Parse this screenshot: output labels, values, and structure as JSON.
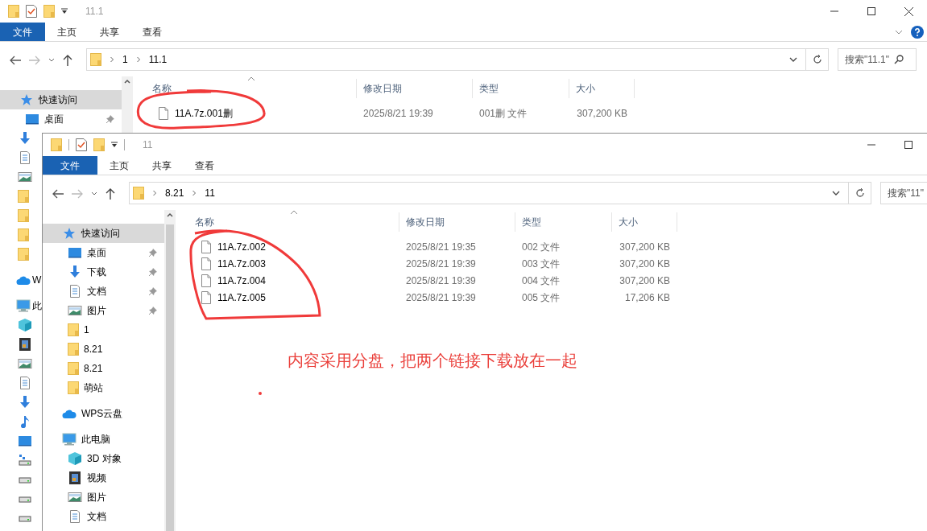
{
  "back_window": {
    "title": "11.1",
    "ribbon_tabs": [
      {
        "kind": "file-menu",
        "label": "文件"
      },
      {
        "kind": "tab",
        "label": "主页"
      },
      {
        "kind": "tab",
        "label": "共享"
      },
      {
        "kind": "tab",
        "label": "查看"
      }
    ],
    "breadcrumb": [
      "1",
      "11.1"
    ],
    "search": {
      "placeholder": "搜索\"11.1\""
    },
    "sidebar": [
      {
        "kind": "quick-access",
        "label": "快速访问",
        "selected": true,
        "children": [
          {
            "kind": "desktop",
            "label": "桌面",
            "pinned": true
          },
          {
            "kind": "download"
          },
          {
            "kind": "document"
          },
          {
            "kind": "pictures"
          },
          {
            "kind": "folder"
          },
          {
            "kind": "folder"
          },
          {
            "kind": "folder"
          },
          {
            "kind": "folder"
          }
        ]
      },
      {
        "kind": "cloud",
        "label": "W",
        "selected": false
      },
      {
        "kind": "computer",
        "label": "此",
        "selected": false,
        "children": [
          {
            "kind": "cube"
          },
          {
            "kind": "video"
          },
          {
            "kind": "pictures"
          },
          {
            "kind": "document"
          },
          {
            "kind": "download"
          },
          {
            "kind": "music"
          },
          {
            "kind": "desktop"
          },
          {
            "kind": "network-drive"
          },
          {
            "kind": "drive"
          },
          {
            "kind": "drive"
          },
          {
            "kind": "drive"
          }
        ]
      }
    ],
    "columns": [
      "名称",
      "修改日期",
      "类型",
      "大小"
    ],
    "rows": [
      {
        "name": "11A.7z.001删",
        "modified": "2025/8/21 19:39",
        "type": "001删 文件",
        "size": "307,200 KB"
      }
    ]
  },
  "front_window": {
    "title": "11",
    "ribbon_tabs": [
      {
        "kind": "file-menu",
        "label": "文件"
      },
      {
        "kind": "tab",
        "label": "主页"
      },
      {
        "kind": "tab",
        "label": "共享"
      },
      {
        "kind": "tab",
        "label": "查看"
      }
    ],
    "breadcrumb": [
      "8.21",
      "11"
    ],
    "search": {
      "placeholder": "搜索\"11\""
    },
    "sidebar": [
      {
        "kind": "quick-access",
        "label": "快速访问",
        "selected": true,
        "children": [
          {
            "kind": "desktop",
            "label": "桌面",
            "pinned": true
          },
          {
            "kind": "download",
            "label": "下载",
            "pinned": true
          },
          {
            "kind": "document",
            "label": "文档",
            "pinned": true
          },
          {
            "kind": "pictures",
            "label": "图片",
            "pinned": true
          },
          {
            "kind": "folder",
            "label": "1",
            "pinned": false
          },
          {
            "kind": "folder",
            "label": "8.21",
            "pinned": false
          },
          {
            "kind": "folder",
            "label": "8.21",
            "pinned": false
          },
          {
            "kind": "folder",
            "label": "萌站",
            "pinned": false
          }
        ]
      },
      {
        "kind": "cloud",
        "label": "WPS云盘",
        "selected": false
      },
      {
        "kind": "computer",
        "label": "此电脑",
        "selected": false,
        "children": [
          {
            "kind": "cube",
            "label": "3D 对象"
          },
          {
            "kind": "video",
            "label": "视频"
          },
          {
            "kind": "pictures",
            "label": "图片"
          },
          {
            "kind": "document",
            "label": "文档"
          }
        ]
      }
    ],
    "columns": [
      "名称",
      "修改日期",
      "类型",
      "大小"
    ],
    "rows": [
      {
        "name": "11A.7z.002",
        "modified": "2025/8/21 19:35",
        "type": "002 文件",
        "size": "307,200 KB"
      },
      {
        "name": "11A.7z.003",
        "modified": "2025/8/21 19:39",
        "type": "003 文件",
        "size": "307,200 KB"
      },
      {
        "name": "11A.7z.004",
        "modified": "2025/8/21 19:39",
        "type": "004 文件",
        "size": "307,200 KB"
      },
      {
        "name": "11A.7z.005",
        "modified": "2025/8/21 19:39",
        "type": "005 文件",
        "size": "17,206 KB"
      }
    ]
  },
  "annotation": {
    "text": "内容采用分盘，把两个链接下载放在一起"
  }
}
